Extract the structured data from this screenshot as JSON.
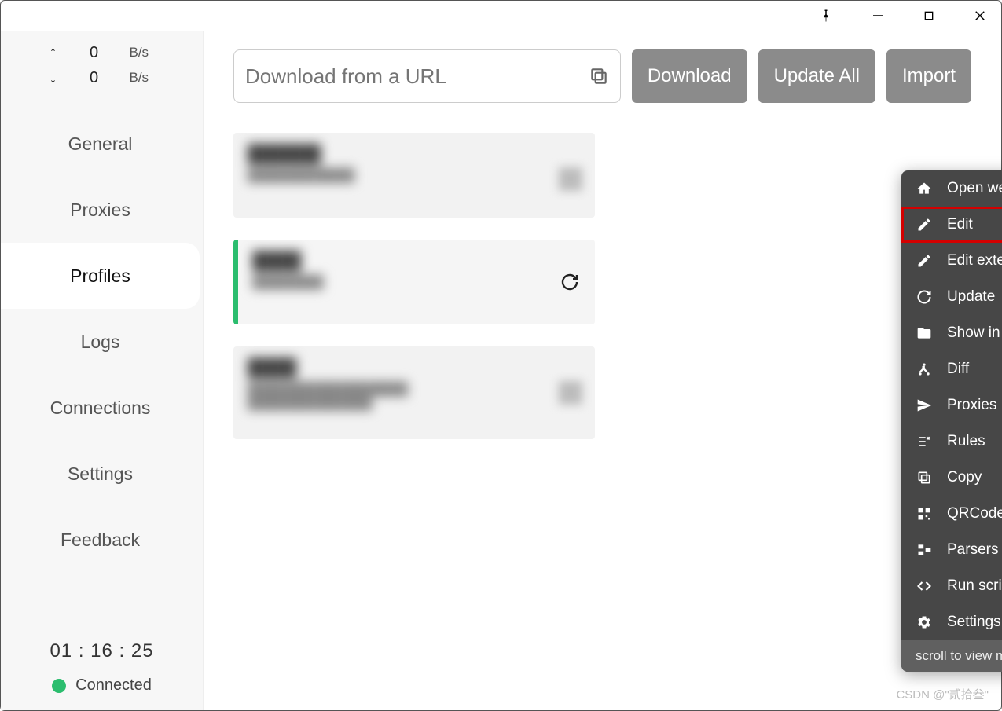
{
  "titlebar": {
    "pin": "📌"
  },
  "speed": {
    "up_value": "0",
    "down_value": "0",
    "unit": "B/s"
  },
  "nav": {
    "items": [
      {
        "label": "General"
      },
      {
        "label": "Proxies"
      },
      {
        "label": "Profiles"
      },
      {
        "label": "Logs"
      },
      {
        "label": "Connections"
      },
      {
        "label": "Settings"
      },
      {
        "label": "Feedback"
      }
    ],
    "active_index": 2
  },
  "status": {
    "timer": "01 : 16 : 25",
    "connected_label": "Connected"
  },
  "toolbar": {
    "url_placeholder": "Download from a URL",
    "download_label": "Download",
    "update_all_label": "Update All",
    "import_label": "Import"
  },
  "profiles": [
    {
      "title": "██████",
      "sub": "████████████",
      "selected": false
    },
    {
      "title": "████",
      "sub": "████████",
      "selected": true
    },
    {
      "title": "████",
      "sub": "██████████████████",
      "sub2": "██████████████",
      "selected": false
    }
  ],
  "context_menu": {
    "items": [
      {
        "icon": "home-icon",
        "label": "Open web page"
      },
      {
        "icon": "pencil-icon",
        "label": "Edit",
        "highlight": true
      },
      {
        "icon": "pencil-icon",
        "label": "Edit externally"
      },
      {
        "icon": "refresh-icon",
        "label": "Update"
      },
      {
        "icon": "folder-icon",
        "label": "Show in folder"
      },
      {
        "icon": "diff-icon",
        "label": "Diff"
      },
      {
        "icon": "send-icon",
        "label": "Proxies"
      },
      {
        "icon": "rules-icon",
        "label": "Rules"
      },
      {
        "icon": "copy-icon",
        "label": "Copy"
      },
      {
        "icon": "qr-icon",
        "label": "QRCode"
      },
      {
        "icon": "parser-icon",
        "label": "Parsers"
      },
      {
        "icon": "code-icon",
        "label": "Run script"
      },
      {
        "icon": "gear-icon",
        "label": "Settings"
      }
    ],
    "footer": "scroll to view more"
  },
  "watermark": "CSDN @\"贰拾叁\""
}
